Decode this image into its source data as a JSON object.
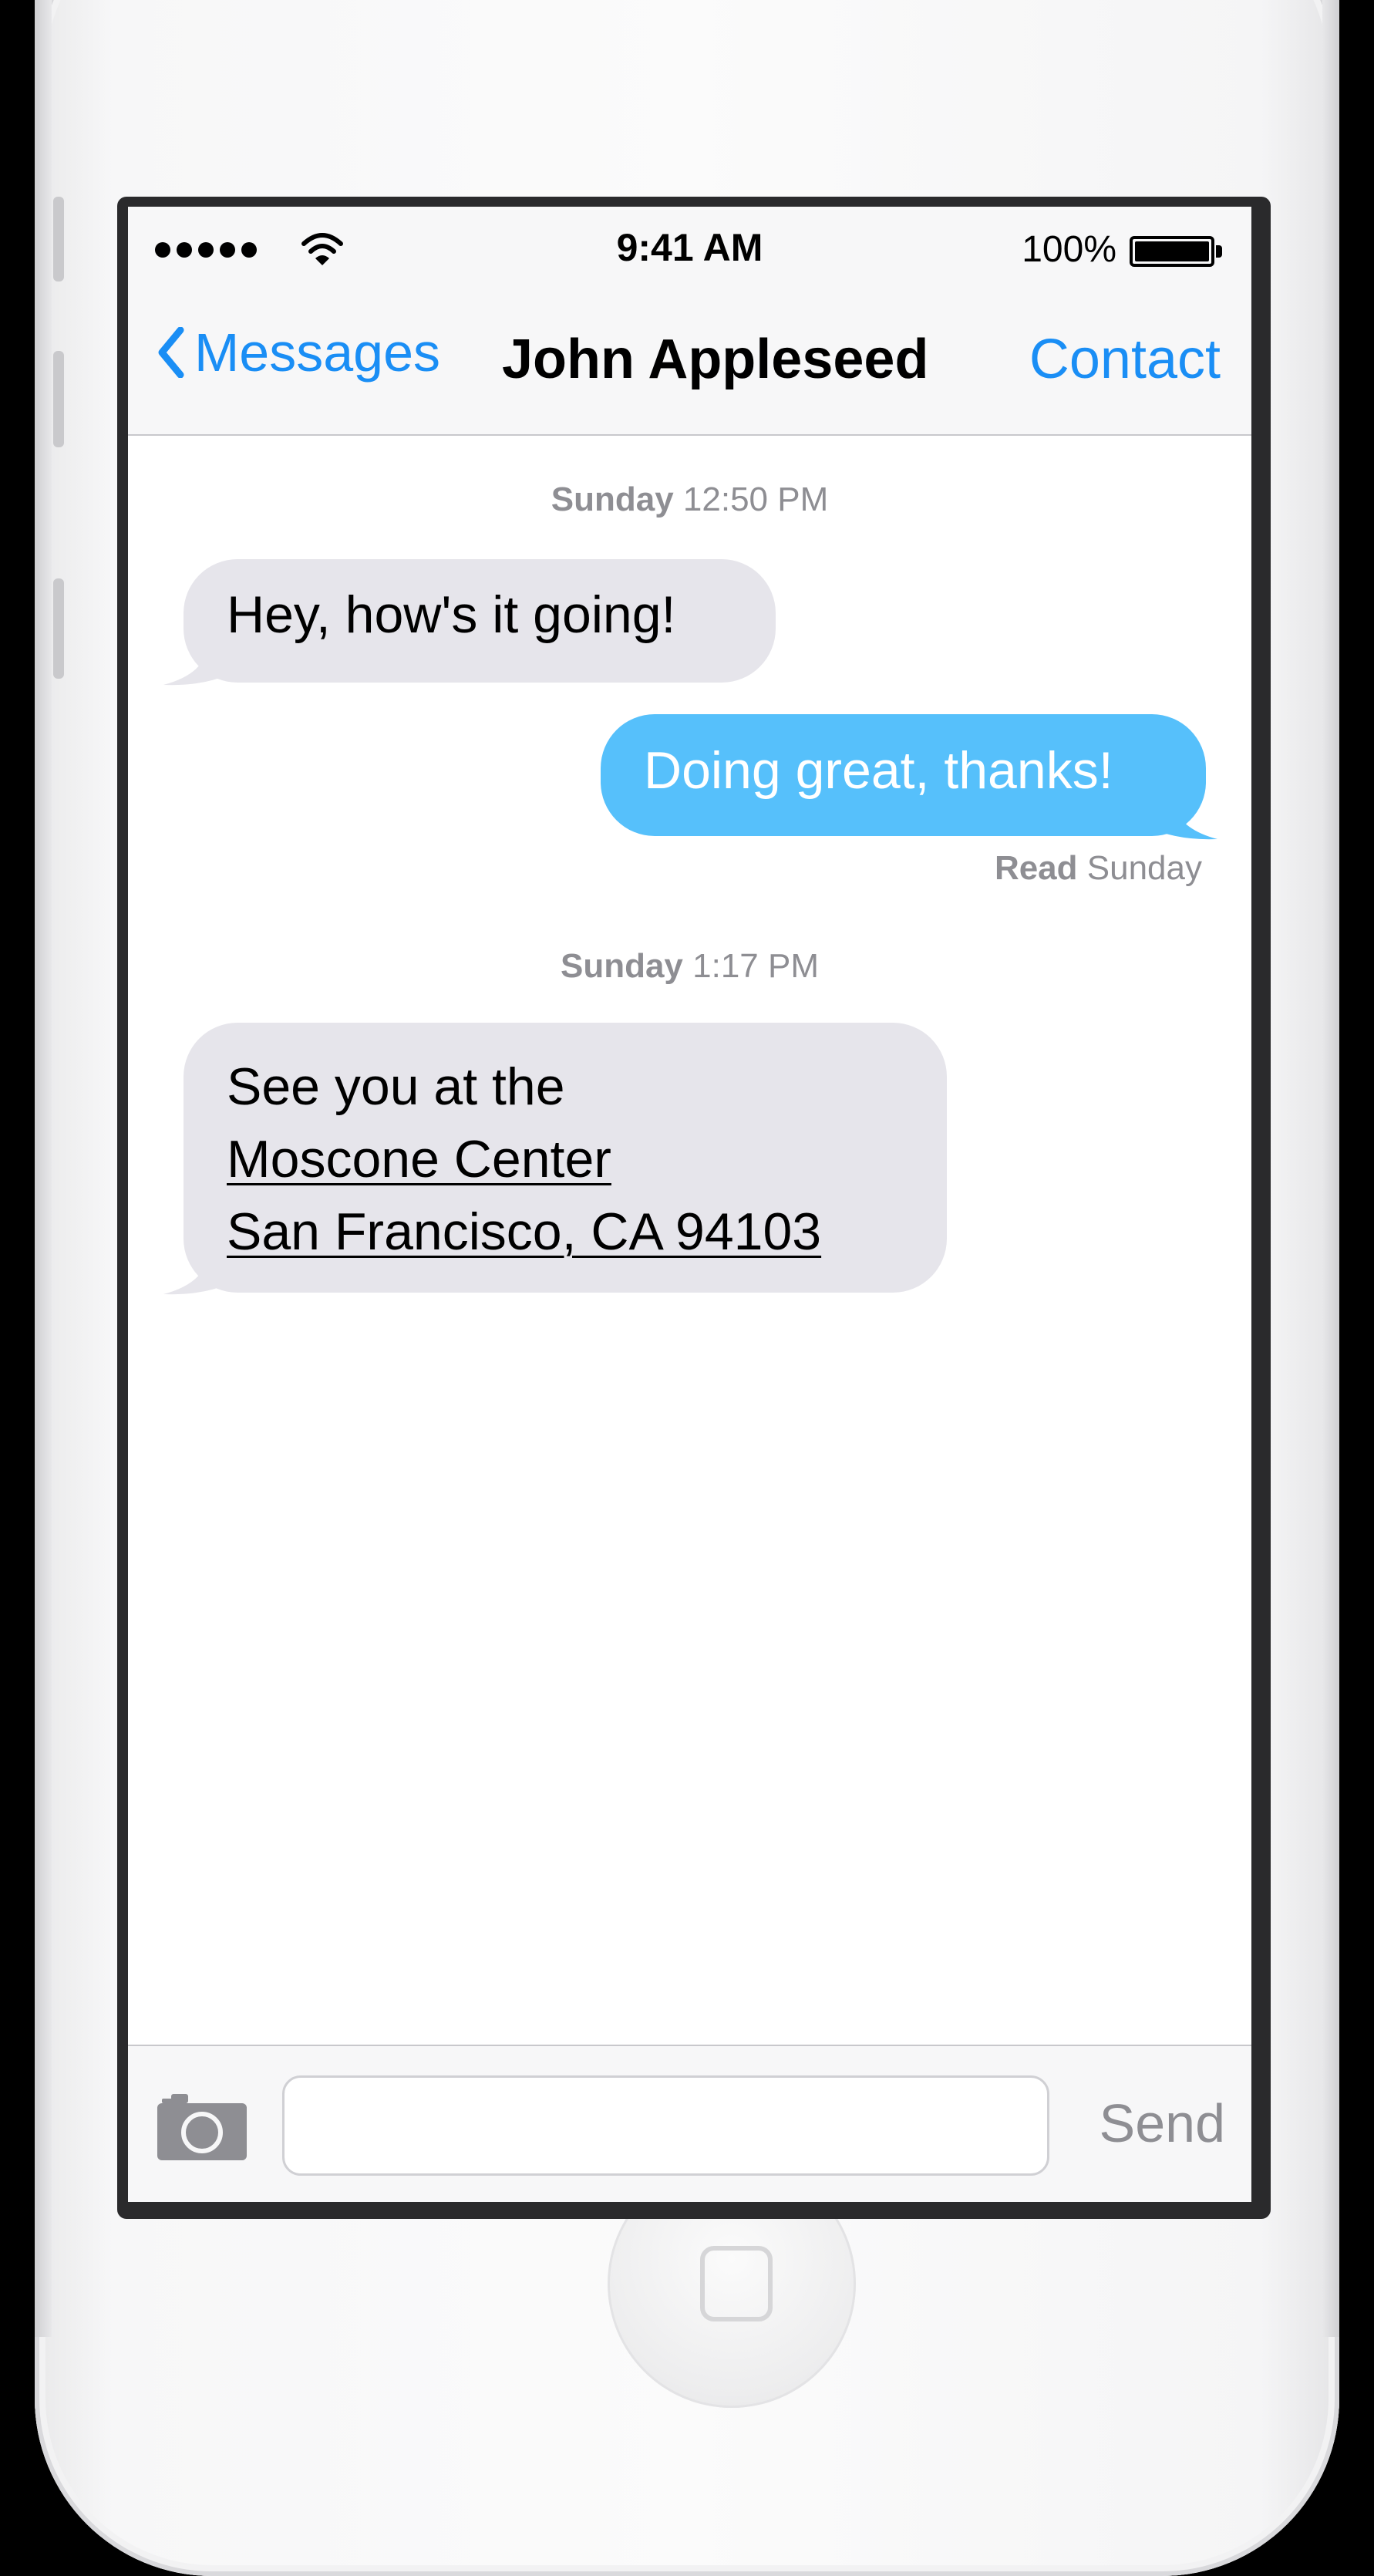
{
  "status_bar": {
    "time": "9:41 AM",
    "battery_percent_label": "100%",
    "battery_level": 1.0,
    "signal_bars": 5,
    "icons": [
      "signal-dots-icon",
      "wifi-icon",
      "battery-icon"
    ]
  },
  "nav": {
    "back_label": "Messages",
    "title": "John Appleseed",
    "contact_label": "Contact",
    "back_icon": "chevron-left-icon"
  },
  "conversation": {
    "timestamp_1": {
      "day": "Sunday",
      "time": "12:50 PM"
    },
    "message_1": {
      "direction": "incoming",
      "text": "Hey, how's it going!"
    },
    "message_2": {
      "direction": "outgoing",
      "text": "Doing great, thanks!"
    },
    "read_receipt": {
      "label": "Read",
      "day": "Sunday"
    },
    "timestamp_2": {
      "day": "Sunday",
      "time": "1:17 PM"
    },
    "message_3": {
      "direction": "incoming",
      "line_1": "See you at the",
      "line_2": "Moscone Center",
      "line_3": "San Francisco, CA 94103"
    }
  },
  "input_bar": {
    "camera_icon": "camera-icon",
    "message_placeholder": "",
    "send_label": "Send"
  },
  "colors": {
    "ios_blue": "#1a8ef5",
    "outgoing_bubble": "#56c0fb",
    "incoming_bubble": "#e6e5eb",
    "meta_gray": "#8e8e93"
  }
}
